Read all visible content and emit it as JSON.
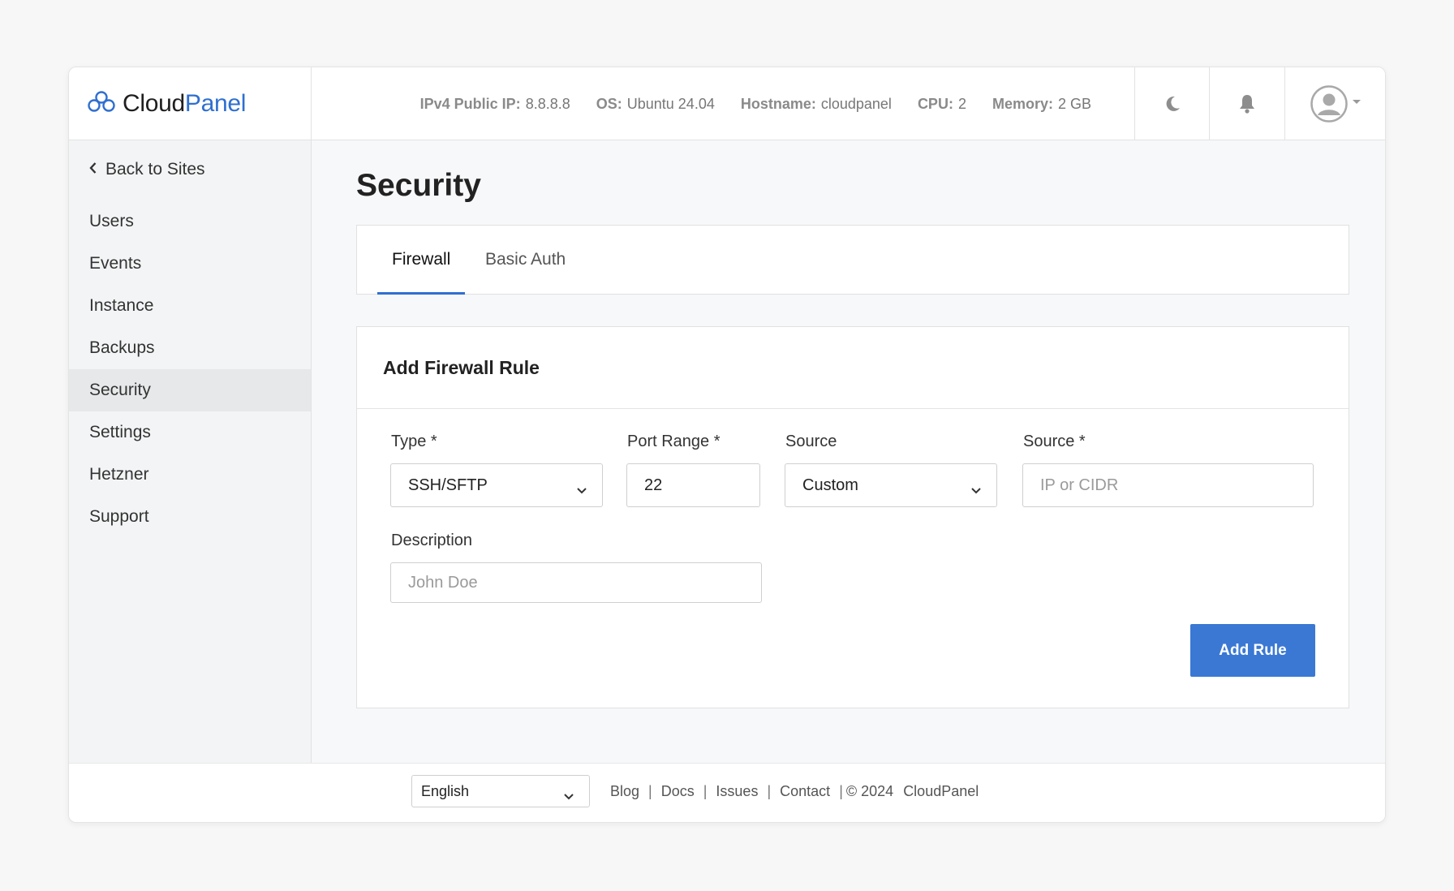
{
  "brand": {
    "name_part1": "Cloud",
    "name_part2": "Panel"
  },
  "sysinfo": [
    {
      "label": "IPv4 Public IP:",
      "value": "8.8.8.8"
    },
    {
      "label": "OS:",
      "value": "Ubuntu 24.04"
    },
    {
      "label": "Hostname:",
      "value": "cloudpanel"
    },
    {
      "label": "CPU:",
      "value": "2"
    },
    {
      "label": "Memory:",
      "value": "2 GB"
    }
  ],
  "sidebar": {
    "back_label": "Back to Sites",
    "items": [
      {
        "label": "Users"
      },
      {
        "label": "Events"
      },
      {
        "label": "Instance"
      },
      {
        "label": "Backups"
      },
      {
        "label": "Security"
      },
      {
        "label": "Settings"
      },
      {
        "label": "Hetzner"
      },
      {
        "label": "Support"
      }
    ],
    "active_item": "Security"
  },
  "main": {
    "title": "Security",
    "tabs": [
      {
        "label": "Firewall"
      },
      {
        "label": "Basic Auth"
      }
    ],
    "active_tab": "Firewall",
    "form": {
      "title": "Add Firewall Rule",
      "type_label": "Type *",
      "type_value": "SSH/SFTP",
      "port_label": "Port Range *",
      "port_value": "22",
      "source_select_label": "Source",
      "source_select_value": "Custom",
      "source_input_label": "Source *",
      "source_input_placeholder": "IP or CIDR",
      "description_label": "Description",
      "description_placeholder": "John Doe",
      "submit_label": "Add Rule"
    }
  },
  "footer": {
    "language": "English",
    "links": [
      "Blog",
      "Docs",
      "Issues",
      "Contact"
    ],
    "copyright": "© 2024",
    "copyright_name": "CloudPanel"
  },
  "colors": {
    "accent": "#2f6fd0",
    "button": "#3a78d4"
  },
  "icons": {
    "logo": "cloud-logo-icon",
    "theme": "moon-icon",
    "notifications": "bell-icon",
    "user": "user-avatar-icon",
    "back": "chevron-left-icon",
    "select": "chevron-down-icon"
  }
}
